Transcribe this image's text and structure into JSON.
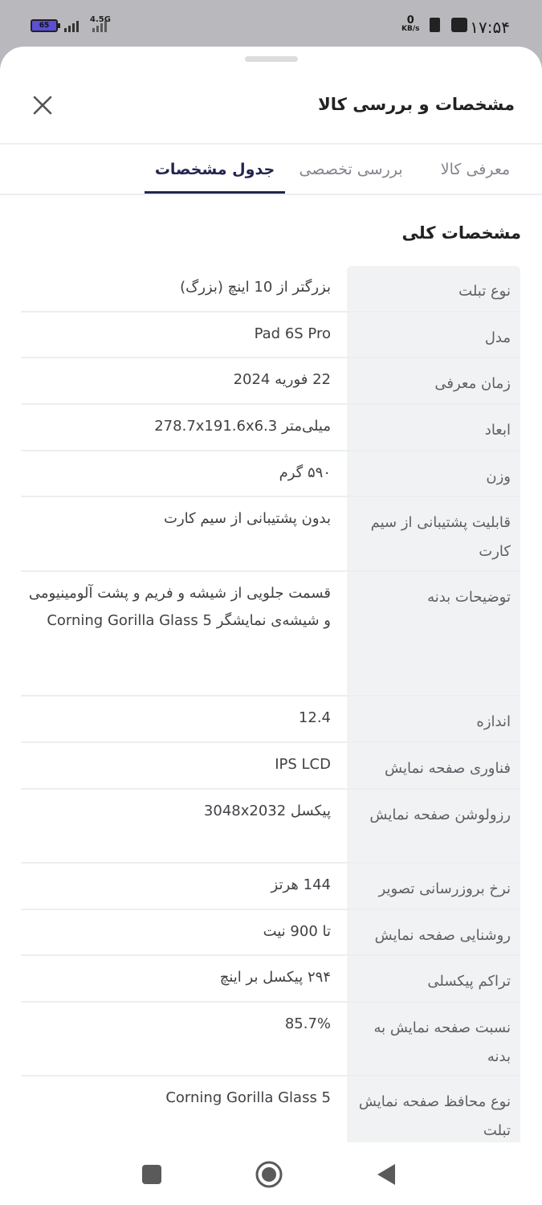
{
  "status_bar": {
    "time": "۱۷:۵۴",
    "battery_level": "65",
    "network": "4.5G",
    "data_rate_value": "0",
    "data_rate_unit": "KB/s"
  },
  "sheet": {
    "title": "مشخصات و بررسی کالا",
    "tabs": [
      {
        "label": "معرفی کالا",
        "active": false
      },
      {
        "label": "بررسی تخصصی",
        "active": false
      },
      {
        "label": "جدول مشخصات",
        "active": true
      }
    ],
    "section_title": "مشخصات کلی",
    "specs": [
      {
        "key": "نوع تبلت",
        "value": "بزرگتر از 10 اینچ (بزرگ)"
      },
      {
        "key": "مدل",
        "value": "Pad 6S Pro"
      },
      {
        "key": "زمان معرفی",
        "value": "22 فوریه 2024"
      },
      {
        "key": "ابعاد",
        "value": "میلی‌متر 278.7x191.6x6.3"
      },
      {
        "key": "وزن",
        "value": "۵۹۰ گرم"
      },
      {
        "key": "قابلیت پشتیبانی از سیم کارت",
        "value": "بدون پشتیبانی از سیم کارت"
      },
      {
        "key": "توضیحات بدنه",
        "value": "قسمت جلویی از شیشه و فریم و پشت آلومینیومی و شیشه‌ی نمایشگر Corning Gorilla Glass 5"
      },
      {
        "key": "اندازه",
        "value": "12.4"
      },
      {
        "key": "فناوری صفحه نمایش",
        "value": "IPS LCD"
      },
      {
        "key": "رزولوشن صفحه نمایش",
        "value": "پیکسل 3048x2032"
      },
      {
        "key": "نرخ بروزرسانی تصویر",
        "value": "144 هرتز"
      },
      {
        "key": "روشنایی صفحه نمایش",
        "value": "تا 900 نیت"
      },
      {
        "key": "تراکم پیکسلی",
        "value": "۲۹۴ پیکسل بر اینچ"
      },
      {
        "key": "نسبت صفحه نمایش به بدنه",
        "value": "85.7%"
      },
      {
        "key": "نوع محافظ صفحه نمایش تبلت",
        "value": "Corning Gorilla Glass 5"
      }
    ]
  },
  "colors": {
    "active_tab": "#23254e",
    "inactive_tab": "#81858b",
    "key_cell_bg": "#f1f2f4"
  },
  "icons": {
    "close": "close-icon",
    "nav_recent": "square-icon",
    "nav_home": "circle-icon",
    "nav_back": "triangle-back-icon"
  }
}
